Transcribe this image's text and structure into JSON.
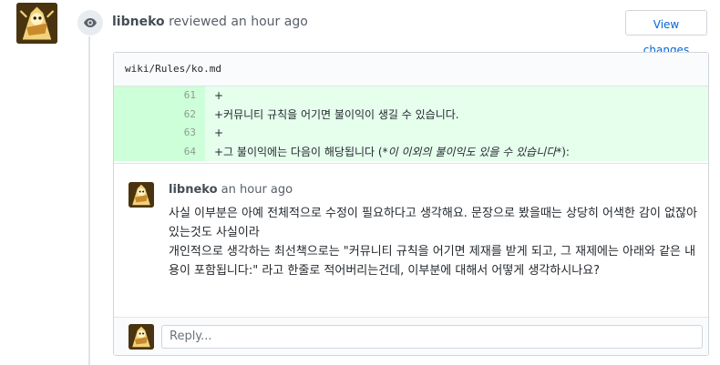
{
  "review": {
    "author": "libneko",
    "action_text": "reviewed an hour ago",
    "view_changes_label": "View changes"
  },
  "file": {
    "path": "wiki/Rules/ko.md",
    "lines": [
      {
        "num": "61",
        "code": "+"
      },
      {
        "num": "62",
        "code": "+커뮤니티 규칙을 어기면 불이익이 생길 수 있습니다."
      },
      {
        "num": "63",
        "code": "+"
      },
      {
        "num": "64",
        "code_prefix": "+그 불이익에는 다음이 해당됩니다 (",
        "code_italic": "*이 이외의 불이익도 있을 수 있습니다*",
        "code_suffix": "):"
      }
    ]
  },
  "comment": {
    "author": "libneko",
    "time": "an hour ago",
    "paragraphs": [
      "사실 이부분은 아예 전체적으로 수정이 필요하다고 생각해요. 문장으로 봤을때는 상당히 어색한 감이 없잖아 있는것도 사실이라",
      "개인적으로 생각하는 최선책으로는 \"커뮤니티 규칙을 어기면 제재를 받게 되고, 그 재제에는 아래와 같은 내용이 포함됩니다:\" 라고 한줄로 적어버리는건데, 이부분에 대해서 어떻게 생각하시나요?"
    ]
  },
  "reply": {
    "placeholder": "Reply..."
  },
  "icons": {
    "review": "eye-icon"
  },
  "colors": {
    "link": "#0366d6",
    "diff_add_bg": "#e6ffed",
    "diff_add_num_bg": "#cdffd8"
  }
}
